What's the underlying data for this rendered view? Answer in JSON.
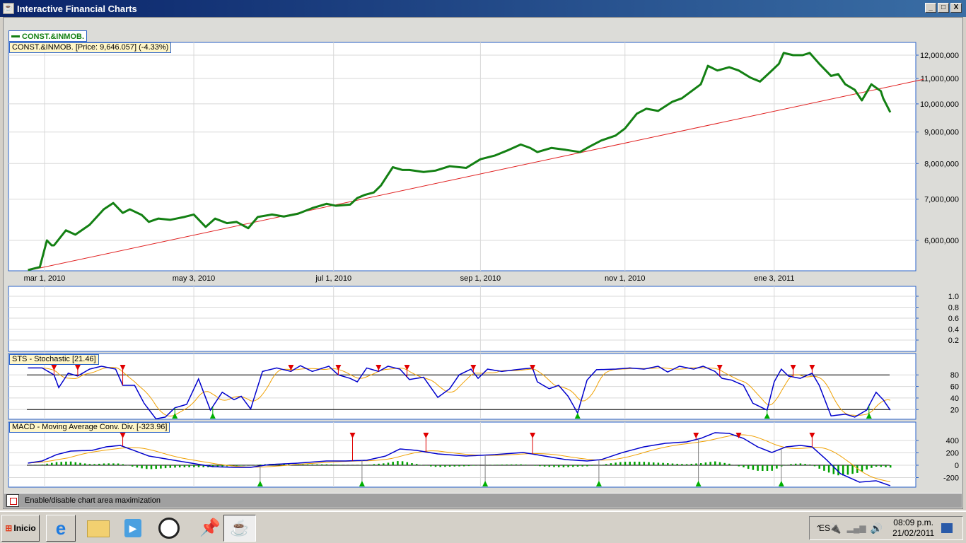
{
  "window": {
    "title": "Interactive Financial Charts",
    "min": "_",
    "max": "□",
    "close": "X"
  },
  "legend": {
    "label": "CONST.&INMOB.",
    "color": "#138013"
  },
  "price_panel": {
    "label": "CONST.&INMOB. [Price: 9,646.057] (-4.33%)"
  },
  "stoch_panel": {
    "label": "STS - Stochastic [21.46]"
  },
  "macd_panel": {
    "label": "MACD - Moving Average Conv. Div. [-323.96]"
  },
  "status": {
    "text": "Enable/disable chart area maximization"
  },
  "taskbar": {
    "start": "Inicio",
    "lang": "ES",
    "time": "08:09 p.m.",
    "date": "21/02/2011"
  },
  "chart_data": [
    {
      "type": "line",
      "title": "CONST.&INMOB.",
      "x_unit": "days since mar 1, 2010",
      "scale": "log",
      "yticks": [
        6000000,
        7000000,
        8000000,
        9000000,
        10000000,
        11000000,
        12000000
      ],
      "ytick_labels": [
        "6,000,000",
        "7,000,000",
        "8,000,000",
        "9,000,000",
        "10,000,000",
        "11,000,000",
        "12,000,000"
      ],
      "xticks": [
        0,
        63,
        122,
        184,
        245,
        308
      ],
      "xtick_labels": [
        "mar 1, 2010",
        "may 3, 2010",
        "jul 1, 2010",
        "sep 1, 2010",
        "nov 1, 2010",
        "ene 3, 2011"
      ],
      "price": {
        "x": [
          -7,
          -2,
          1,
          3,
          4,
          9,
          13,
          19,
          25,
          29,
          33,
          36,
          41,
          44,
          48,
          53,
          59,
          63,
          68,
          72,
          77,
          81,
          86,
          90,
          96,
          101,
          107,
          113,
          119,
          123,
          129,
          132,
          135,
          139,
          142,
          147,
          151,
          154,
          160,
          165,
          171,
          178,
          184,
          190,
          196,
          201,
          205,
          208,
          214,
          220,
          226,
          230,
          235,
          241,
          245,
          250,
          254,
          259,
          265,
          269,
          277,
          280,
          284,
          289,
          293,
          298,
          302,
          307,
          310,
          312,
          316,
          320,
          323,
          327,
          332,
          335,
          338,
          342,
          345,
          349,
          353,
          354,
          357
        ],
        "y": [
          5.37,
          5.43,
          6.0,
          5.89,
          5.89,
          6.23,
          6.13,
          6.36,
          6.74,
          6.9,
          6.65,
          6.74,
          6.6,
          6.43,
          6.51,
          6.48,
          6.55,
          6.61,
          6.31,
          6.51,
          6.4,
          6.43,
          6.28,
          6.55,
          6.61,
          6.56,
          6.63,
          6.77,
          6.88,
          6.83,
          6.86,
          7.03,
          7.11,
          7.18,
          7.37,
          7.89,
          7.81,
          7.81,
          7.75,
          7.79,
          7.92,
          7.87,
          8.13,
          8.24,
          8.42,
          8.59,
          8.48,
          8.35,
          8.48,
          8.42,
          8.35,
          8.52,
          8.72,
          8.88,
          9.12,
          9.64,
          9.82,
          9.74,
          10.08,
          10.21,
          10.76,
          11.53,
          11.33,
          11.47,
          11.33,
          11.03,
          10.87,
          11.33,
          11.62,
          12.1,
          12.0,
          12.0,
          12.1,
          11.62,
          11.1,
          11.18,
          10.76,
          10.54,
          10.13,
          10.76,
          10.49,
          10.21,
          9.69
        ],
        "color": "#138013"
      },
      "trendline": {
        "x": [
          -7,
          371
        ],
        "y": [
          5.36,
          10.96
        ],
        "color": "#e02020"
      }
    },
    {
      "type": "line",
      "title": "empty panel",
      "yticks": [
        0.2,
        0.4,
        0.6,
        0.8,
        1.0
      ],
      "ytick_labels": [
        "0.2",
        "0.4",
        "0.6",
        "0.8",
        "1.0"
      ]
    },
    {
      "type": "line",
      "title": "STS - Stochastic",
      "ylim": [
        0,
        100
      ],
      "levels": [
        20,
        80
      ],
      "yticks": [
        20,
        40,
        60,
        80
      ],
      "ytick_labels": [
        "20",
        "40",
        "60",
        "80"
      ],
      "k": {
        "x": [
          -7,
          -1,
          4,
          6,
          10,
          14,
          19,
          24,
          30,
          33,
          38,
          42,
          47,
          51,
          55,
          60,
          65,
          70,
          75,
          80,
          83,
          87,
          92,
          98,
          104,
          108,
          113,
          120,
          124,
          129,
          132,
          136,
          141,
          145,
          150,
          154,
          160,
          166,
          171,
          175,
          180,
          183,
          187,
          193,
          201,
          206,
          208,
          213,
          217,
          221,
          225,
          229,
          233,
          241,
          247,
          253,
          259,
          263,
          268,
          274,
          278,
          283,
          286,
          290,
          295,
          299,
          305,
          308,
          311,
          314,
          319,
          324,
          327,
          332,
          338,
          342,
          347,
          351,
          354,
          357
        ],
        "y": [
          92,
          92,
          80,
          58,
          83,
          78,
          90,
          95,
          90,
          62,
          62,
          31,
          4,
          7,
          23,
          29,
          73,
          19,
          50,
          37,
          43,
          21,
          86,
          92,
          86,
          96,
          86,
          95,
          80,
          74,
          68,
          92,
          86,
          95,
          90,
          72,
          76,
          41,
          56,
          80,
          90,
          74,
          90,
          86,
          90,
          92,
          68,
          56,
          62,
          43,
          14,
          71,
          89,
          90,
          92,
          90,
          95,
          85,
          95,
          90,
          95,
          86,
          74,
          71,
          62,
          31,
          19,
          68,
          90,
          78,
          74,
          83,
          62,
          9,
          12,
          7,
          19,
          50,
          37,
          19
        ],
        "color": "#0000cc"
      },
      "d_color": "#f0a000",
      "sell_signals": [
        4,
        14,
        33,
        104,
        124,
        141,
        153,
        181,
        206,
        285,
        316,
        324
      ],
      "buy_signals": [
        55,
        71,
        225,
        305,
        348
      ]
    },
    {
      "type": "line",
      "title": "MACD - Moving Average Conv. Div.",
      "yticks": [
        -200,
        0,
        200,
        400
      ],
      "ytick_labels": [
        "-200",
        "0",
        "200",
        "400"
      ],
      "macd": {
        "x": [
          -7,
          -1,
          5,
          11,
          20,
          26,
          32,
          36,
          44,
          53,
          62,
          71,
          80,
          87,
          95,
          107,
          119,
          127,
          136,
          144,
          150,
          157,
          166,
          178,
          190,
          202,
          211,
          220,
          229,
          235,
          244,
          253,
          262,
          271,
          277,
          283,
          289,
          295,
          301,
          307,
          313,
          319,
          324,
          330,
          336,
          344,
          351,
          357
        ],
        "y": [
          34,
          69,
          171,
          229,
          240,
          297,
          320,
          263,
          149,
          91,
          34,
          -23,
          -34,
          -34,
          11,
          34,
          69,
          69,
          80,
          149,
          263,
          240,
          183,
          149,
          171,
          206,
          149,
          91,
          69,
          91,
          206,
          297,
          354,
          377,
          434,
          526,
          514,
          434,
          297,
          206,
          297,
          320,
          297,
          91,
          -137,
          -274,
          -251,
          -331
        ],
        "color": "#0000cc"
      },
      "signal_color": "#f0a000",
      "histogram_color": "#00a000",
      "sell_signals": [
        33,
        130,
        161,
        206,
        275,
        293,
        324
      ],
      "buy_signals": [
        91,
        134,
        186,
        234,
        276,
        311
      ]
    }
  ]
}
